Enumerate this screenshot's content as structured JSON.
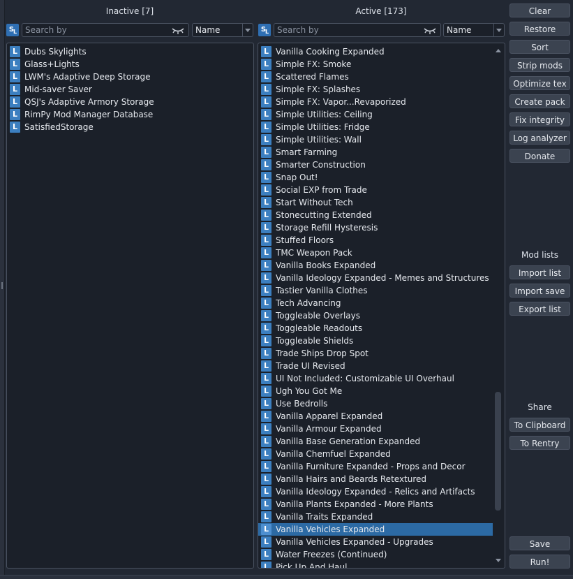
{
  "inactive": {
    "title": "Inactive [7]",
    "search_placeholder": "Search by",
    "sort_value": "Name",
    "items": [
      "Dubs Skylights",
      "Glass+Lights",
      "LWM's Adaptive Deep Storage",
      "Mid-saver Saver",
      "QSJ's Adaptive Armory Storage",
      "RimPy Mod Manager Database",
      "SatisfiedStorage"
    ]
  },
  "active": {
    "title": "Active [173]",
    "search_placeholder": "Search by",
    "sort_value": "Name",
    "selected_item": "Vanilla Vehicles Expanded",
    "items": [
      "Vanilla Cooking Expanded",
      "Simple FX: Smoke",
      "Scattered Flames",
      "Simple FX: Splashes",
      "Simple FX: Vapor...Revaporized",
      "Simple Utilities: Ceiling",
      "Simple Utilities: Fridge",
      "Simple Utilities: Wall",
      "Smart Farming",
      "Smarter Construction",
      "Snap Out!",
      "Social EXP from Trade",
      "Start Without Tech",
      "Stonecutting Extended",
      "Storage Refill Hysteresis",
      "Stuffed Floors",
      "TMC Weapon Pack",
      "Vanilla Books Expanded",
      "Vanilla Ideology Expanded - Memes and Structures",
      "Tastier Vanilla Clothes",
      "Tech Advancing",
      "Toggleable Overlays",
      "Toggleable Readouts",
      "Toggleable Shields",
      "Trade Ships Drop Spot",
      "Trade UI Revised",
      "UI Not Included: Customizable UI Overhaul",
      "Ugh You Got Me",
      "Use Bedrolls",
      "Vanilla Apparel Expanded",
      "Vanilla Armour Expanded",
      "Vanilla Base Generation Expanded",
      "Vanilla Chemfuel Expanded",
      "Vanilla Furniture Expanded - Props and Decor",
      "Vanilla Hairs and Beards Retextured",
      "Vanilla Ideology Expanded - Relics and Artifacts",
      "Vanilla Plants Expanded - More Plants",
      "Vanilla Traits Expanded",
      "Vanilla Vehicles Expanded",
      "Vanilla Vehicles Expanded - Upgrades",
      "Water Freezes (Continued)",
      "Pick Up And Haul"
    ]
  },
  "badge_letter": "L",
  "search_icon_letters": "SL",
  "buttons": {
    "clear": "Clear",
    "restore": "Restore",
    "sort": "Sort",
    "strip_mods": "Strip mods",
    "optimize_tex": "Optimize tex",
    "create_pack": "Create pack",
    "fix_integrity": "Fix integrity",
    "log_analyzer": "Log analyzer",
    "donate": "Donate",
    "import_list": "Import list",
    "import_save": "Import save",
    "export_list": "Export list",
    "to_clipboard": "To Clipboard",
    "to_rentry": "To Rentry",
    "save": "Save",
    "run": "Run!"
  },
  "sections": {
    "mod_lists": "Mod lists",
    "share": "Share"
  },
  "colors": {
    "background": "#222833",
    "badge": "#3c7fc0",
    "selected_row": "#2c6aa4"
  }
}
